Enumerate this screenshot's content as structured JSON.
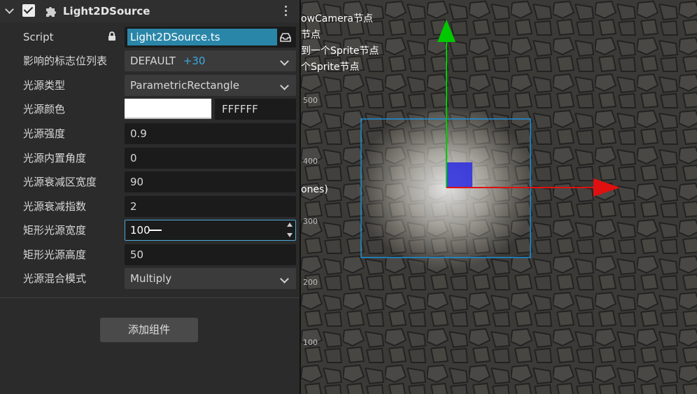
{
  "component": {
    "title": "Light2DSource"
  },
  "rows": {
    "script": {
      "label": "Script",
      "value": "Light2DSource.ts"
    },
    "layers": {
      "label": "影响的标志位列表",
      "value": "DEFAULT",
      "extra": "+30"
    },
    "light_type": {
      "label": "光源类型",
      "value": "ParametricRectangle"
    },
    "color": {
      "label": "光源颜色",
      "hex": "FFFFFF",
      "swatch": "#ffffff"
    },
    "intensity": {
      "label": "光源强度",
      "value": "0.9"
    },
    "inner_angle": {
      "label": "光源内置角度",
      "value": "0"
    },
    "falloff_width": {
      "label": "光源衰减区宽度",
      "value": "90"
    },
    "falloff_exp": {
      "label": "光源衰减指数",
      "value": "2"
    },
    "rect_width": {
      "label": "矩形光源宽度",
      "value": "100"
    },
    "rect_height": {
      "label": "矩形光源高度",
      "value": "50"
    },
    "blend_mode": {
      "label": "光源混合模式",
      "value": "Multiply"
    }
  },
  "add_component": "添加组件",
  "scene": {
    "texts": [
      "owCamera节点",
      "节点",
      "到一个Sprite节点",
      "个Sprite节点",
      "ones)"
    ],
    "yticks": [
      "500",
      "400",
      "300",
      "200",
      "100"
    ],
    "colors": {
      "selection": "#1e90d6",
      "y_axis": "#00c800",
      "x_axis": "#e01010",
      "handle": "#2a2ae0"
    }
  }
}
